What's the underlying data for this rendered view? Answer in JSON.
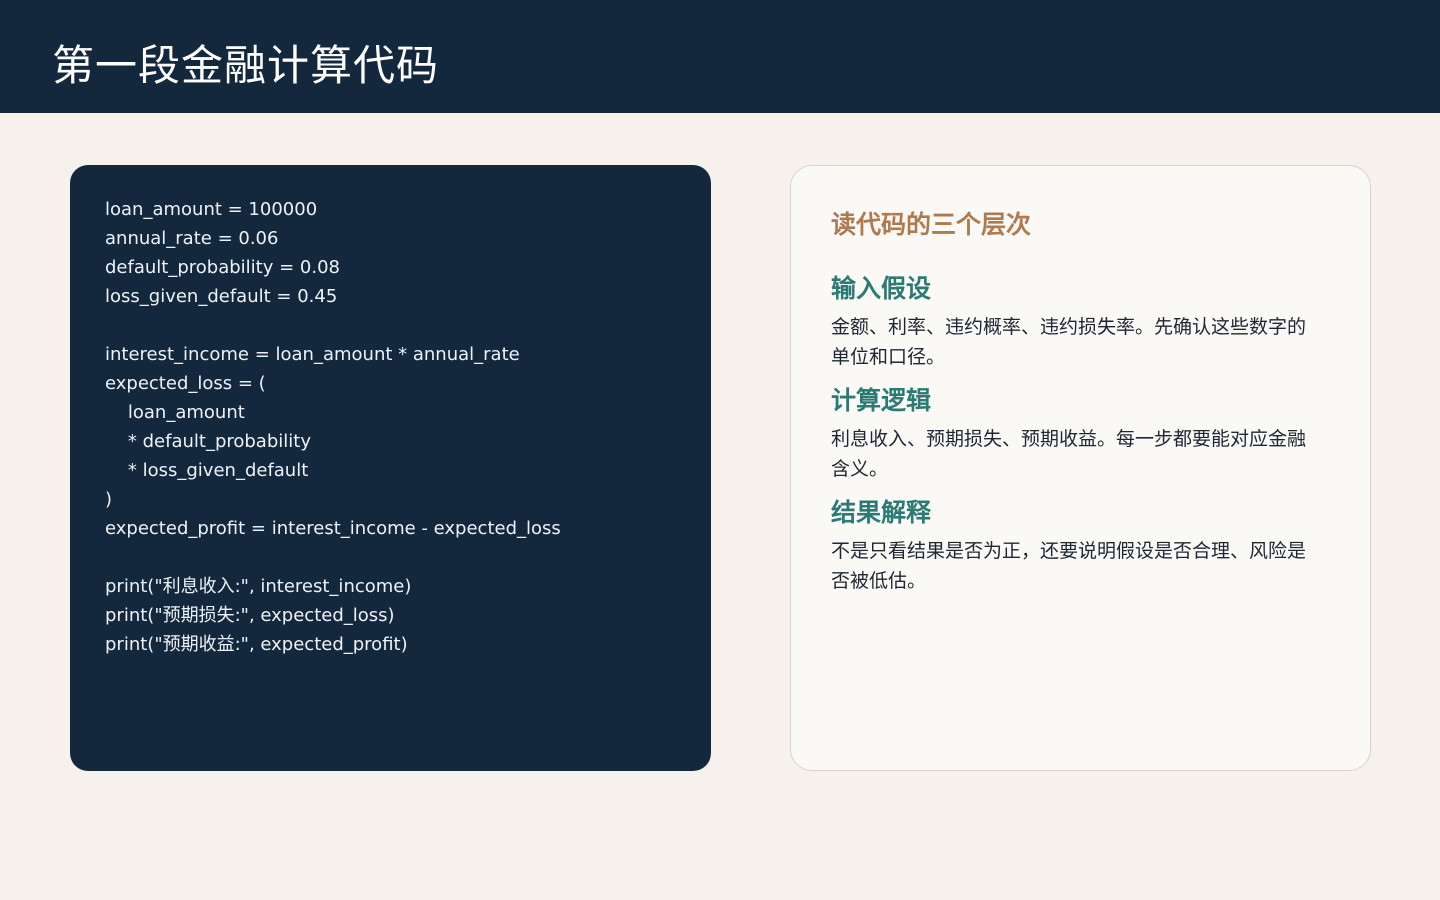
{
  "header": {
    "title": "第一段金融计算代码"
  },
  "code": {
    "lines": [
      "loan_amount = 100000",
      "annual_rate = 0.06",
      "default_probability = 0.08",
      "loss_given_default = 0.45",
      "",
      "interest_income = loan_amount * annual_rate",
      "expected_loss = (",
      "    loan_amount",
      "    * default_probability",
      "    * loss_given_default",
      ")",
      "expected_profit = interest_income - expected_loss",
      "",
      "print(\"利息收入:\", interest_income)",
      "print(\"预期损失:\", expected_loss)",
      "print(\"预期收益:\", expected_profit)"
    ]
  },
  "card": {
    "title": "读代码的三个层次",
    "sections": [
      {
        "heading": "输入假设",
        "body": "金额、利率、违约概率、违约损失率。先确认这些数字的单位和口径。"
      },
      {
        "heading": "计算逻辑",
        "body": "利息收入、预期损失、预期收益。每一步都要能对应金融含义。"
      },
      {
        "heading": "结果解释",
        "body": "不是只看结果是否为正，还要说明假设是否合理、风险是否被低估。"
      }
    ]
  },
  "colors": {
    "navy": "#13283d",
    "background": "#f6f1ec",
    "card_title": "#b07a4f",
    "section_heading": "#2b7b74"
  }
}
